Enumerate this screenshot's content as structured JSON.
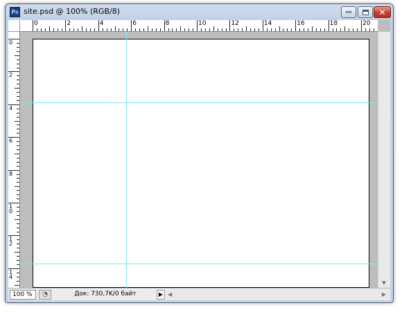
{
  "window": {
    "app_badge": "Ps",
    "title": "site.psd @ 100% (RGB/8)",
    "close_glyph": "✕"
  },
  "rulers": {
    "unit": "cm",
    "horizontal_labels": [
      "0",
      "2",
      "4",
      "6",
      "8",
      "10",
      "12",
      "14",
      "16",
      "18",
      "20"
    ],
    "vertical_labels": [
      "0",
      "2",
      "4",
      "6",
      "8",
      "10",
      "12",
      "14"
    ]
  },
  "guides": {
    "vertical_cm": [
      5.7
    ],
    "horizontal_cm": [
      3.9,
      13.7
    ],
    "color": "#7ae8ee"
  },
  "document": {
    "background": "#ffffff",
    "pasteboard": "#bdbdbd"
  },
  "statusbar": {
    "zoom": "100 %",
    "doc_info": "Док: 730,7K/0 байт",
    "menu_arrow": "▶"
  },
  "icons": {
    "app": "photoshop-icon",
    "minimize": "minimize-icon",
    "maximize": "maximize-icon",
    "close": "close-icon",
    "status_button": "status-view-icon"
  }
}
